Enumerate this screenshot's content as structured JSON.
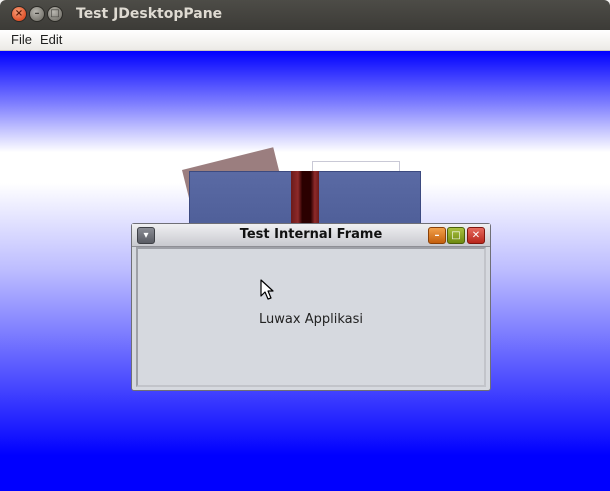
{
  "window": {
    "title": "Test JDesktopPane",
    "close_glyph": "×",
    "min_glyph": "–",
    "max_glyph": "□"
  },
  "menubar": {
    "items": [
      {
        "label": "File"
      },
      {
        "label": "Edit"
      }
    ]
  },
  "internal_frame": {
    "title": "Test Internal Frame",
    "content_label": "Luwax Applikasi",
    "sys_glyph": "▾",
    "min_glyph": "–",
    "max_glyph": "□",
    "close_glyph": "✕"
  },
  "colors": {
    "desktop_top": "#0000ff",
    "desktop_mid": "#ffffff",
    "frame_close": "#b8261c",
    "frame_min": "#c4600e",
    "frame_max": "#6e8a10"
  },
  "icons": {
    "window_close": "close-icon",
    "window_minimize": "minimize-icon",
    "window_maximize": "maximize-icon",
    "frame_system": "system-menu-icon",
    "frame_iconify": "iconify-icon",
    "frame_maximize": "maximize-icon",
    "frame_close": "close-icon",
    "cursor": "mouse-pointer-icon"
  }
}
